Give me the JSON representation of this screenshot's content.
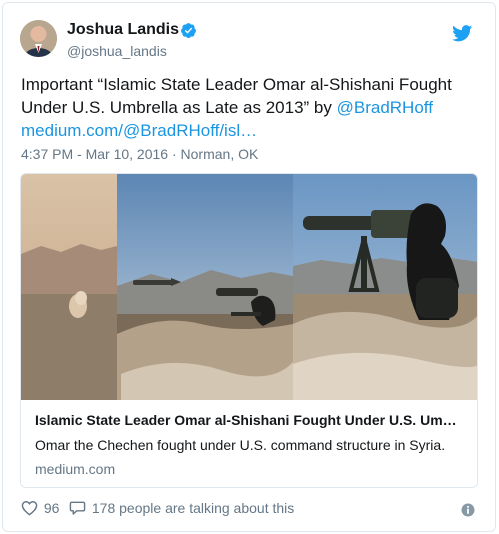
{
  "author": {
    "name": "Joshua Landis",
    "handle": "@joshua_landis"
  },
  "tweet": {
    "text_plain": "Important “Islamic State Leader Omar al-Shishani Fought Under U.S. Umbrella as Late as 2013” by ",
    "mention": "@BradRHoff",
    "url": "medium.com/@BradRHoff/isl…",
    "timestamp": "4:37 PM - Mar 10, 2016",
    "location": "Norman, OK"
  },
  "card": {
    "title": "Islamic State Leader Omar al-Shishani Fought Under U.S. Um…",
    "description": "Omar the Chechen fought under U.S. command structure in Syria.",
    "domain": "medium.com"
  },
  "actions": {
    "likes": "96",
    "talking": "178 people are talking about this"
  },
  "colors": {
    "link": "#1b95e0",
    "verified": "#1da1f2",
    "muted": "#657786"
  }
}
